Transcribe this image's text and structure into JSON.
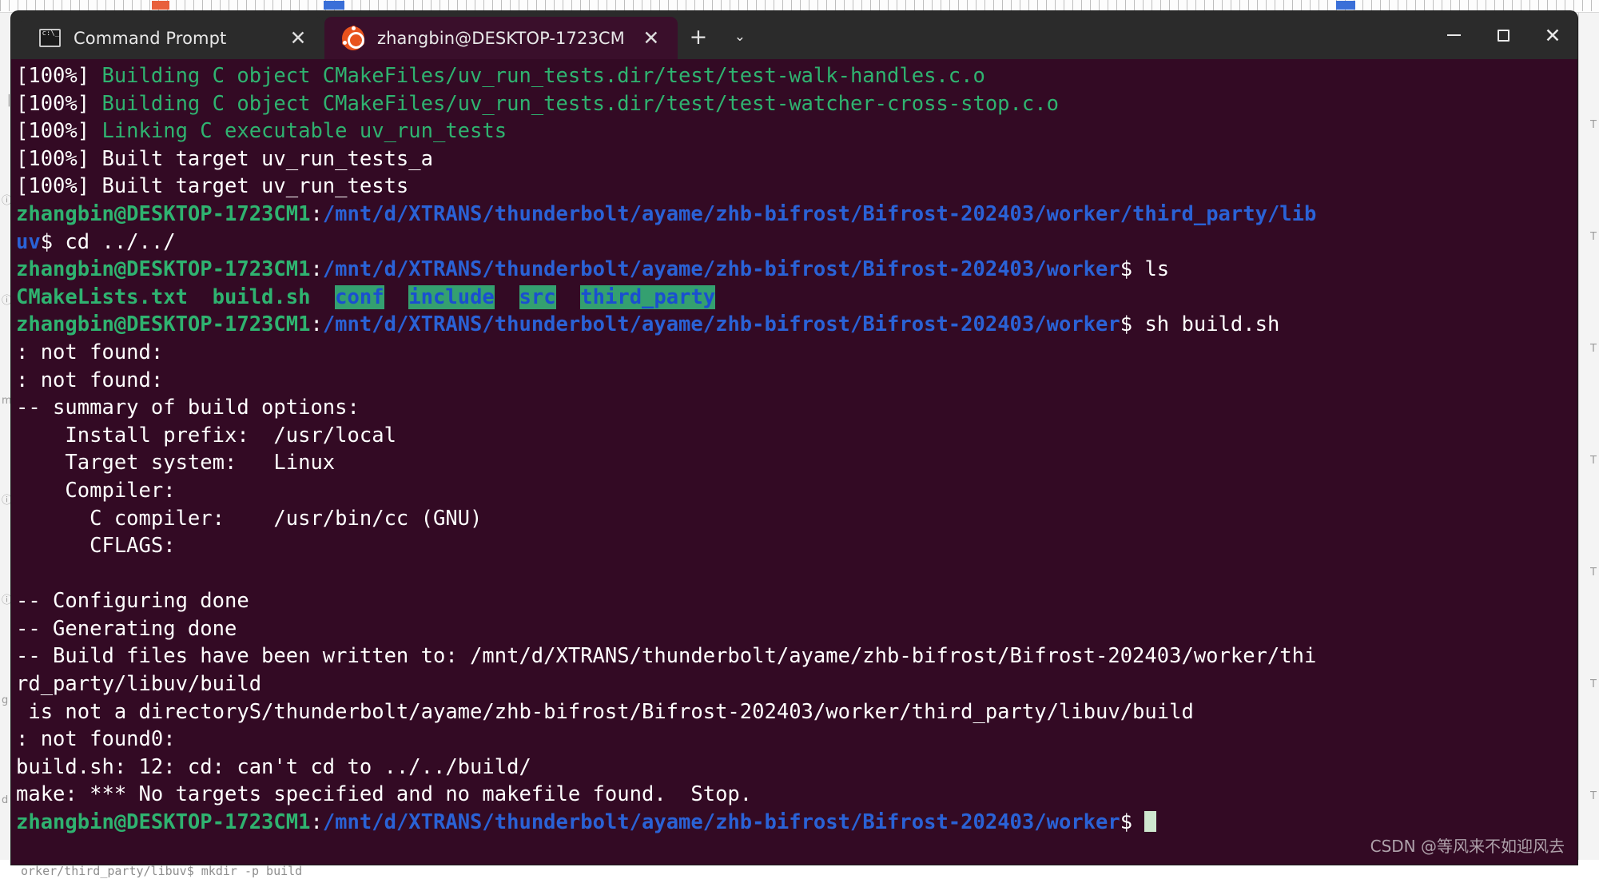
{
  "window": {
    "tabs": [
      {
        "label": "Command Prompt",
        "icon": "command-prompt-icon",
        "active": false,
        "close_label": "✕"
      },
      {
        "label": "zhangbin@DESKTOP-1723CM",
        "icon": "ubuntu-icon",
        "active": true,
        "close_label": "✕"
      }
    ],
    "new_tab_label": "+",
    "tab_dropdown_label": "⌄",
    "controls": {
      "minimize": "—",
      "maximize": "□",
      "close": "✕"
    }
  },
  "terminal": {
    "colors": {
      "background": "#330a24",
      "foreground": "#ffffff",
      "green": "#2fb370",
      "blue": "#2a62d6",
      "dir_highlight_bg": "#34a070",
      "dir_highlight_fg": "#1a4fd0",
      "cursor": "#cfe7cf"
    },
    "lines": [
      {
        "segments": [
          {
            "text": "[100%] ",
            "class": "c-white"
          },
          {
            "text": "Building C object CMakeFiles/uv_run_tests.dir/test/test-walk-handles.c.o",
            "class": "c-green"
          }
        ]
      },
      {
        "segments": [
          {
            "text": "[100%] ",
            "class": "c-white"
          },
          {
            "text": "Building C object CMakeFiles/uv_run_tests.dir/test/test-watcher-cross-stop.c.o",
            "class": "c-green"
          }
        ]
      },
      {
        "segments": [
          {
            "text": "[100%] ",
            "class": "c-white"
          },
          {
            "text": "Linking C executable uv_run_tests",
            "class": "c-green"
          }
        ]
      },
      {
        "segments": [
          {
            "text": "[100%] Built target uv_run_tests_a",
            "class": "c-white"
          }
        ]
      },
      {
        "segments": [
          {
            "text": "[100%] Built target uv_run_tests",
            "class": "c-white"
          }
        ]
      },
      {
        "segments": [
          {
            "text": "zhangbin@DESKTOP-1723CM1",
            "class": "c-green c-bold"
          },
          {
            "text": ":",
            "class": "c-white"
          },
          {
            "text": "/mnt/d/XTRANS/thunderbolt/ayame/zhb-bifrost/Bifrost-202403/worker/third_party/lib",
            "class": "c-blue c-bold"
          }
        ]
      },
      {
        "segments": [
          {
            "text": "uv",
            "class": "c-blue c-bold"
          },
          {
            "text": "$ cd ../../",
            "class": "c-white"
          }
        ]
      },
      {
        "segments": [
          {
            "text": "zhangbin@DESKTOP-1723CM1",
            "class": "c-green c-bold"
          },
          {
            "text": ":",
            "class": "c-white"
          },
          {
            "text": "/mnt/d/XTRANS/thunderbolt/ayame/zhb-bifrost/Bifrost-202403/worker",
            "class": "c-blue c-bold"
          },
          {
            "text": "$ ls",
            "class": "c-white"
          }
        ]
      },
      {
        "segments": [
          {
            "text": "CMakeLists.txt  build.sh  ",
            "class": "c-green c-bold"
          },
          {
            "text": "conf",
            "class": "dir-hl"
          },
          {
            "text": "  ",
            "class": "c-white"
          },
          {
            "text": "include",
            "class": "dir-hl"
          },
          {
            "text": "  ",
            "class": "c-white"
          },
          {
            "text": "src",
            "class": "dir-hl"
          },
          {
            "text": "  ",
            "class": "c-white"
          },
          {
            "text": "third_party",
            "class": "dir-hl"
          }
        ]
      },
      {
        "segments": [
          {
            "text": "zhangbin@DESKTOP-1723CM1",
            "class": "c-green c-bold"
          },
          {
            "text": ":",
            "class": "c-white"
          },
          {
            "text": "/mnt/d/XTRANS/thunderbolt/ayame/zhb-bifrost/Bifrost-202403/worker",
            "class": "c-blue c-bold"
          },
          {
            "text": "$ sh build.sh",
            "class": "c-white"
          }
        ]
      },
      {
        "segments": [
          {
            "text": ": not found:",
            "class": "c-white"
          }
        ]
      },
      {
        "segments": [
          {
            "text": ": not found:",
            "class": "c-white"
          }
        ]
      },
      {
        "segments": [
          {
            "text": "-- summary of build options:",
            "class": "c-white"
          }
        ]
      },
      {
        "segments": [
          {
            "text": "    Install prefix:  /usr/local",
            "class": "c-white"
          }
        ]
      },
      {
        "segments": [
          {
            "text": "    Target system:   Linux",
            "class": "c-white"
          }
        ]
      },
      {
        "segments": [
          {
            "text": "    Compiler:",
            "class": "c-white"
          }
        ]
      },
      {
        "segments": [
          {
            "text": "      C compiler:    /usr/bin/cc (GNU)",
            "class": "c-white"
          }
        ]
      },
      {
        "segments": [
          {
            "text": "      CFLAGS:",
            "class": "c-white"
          }
        ]
      },
      {
        "segments": [
          {
            "text": "",
            "class": "c-white"
          }
        ]
      },
      {
        "segments": [
          {
            "text": "-- Configuring done",
            "class": "c-white"
          }
        ]
      },
      {
        "segments": [
          {
            "text": "-- Generating done",
            "class": "c-white"
          }
        ]
      },
      {
        "segments": [
          {
            "text": "-- Build files have been written to: /mnt/d/XTRANS/thunderbolt/ayame/zhb-bifrost/Bifrost-202403/worker/thi",
            "class": "c-white"
          }
        ]
      },
      {
        "segments": [
          {
            "text": "rd_party/libuv/build",
            "class": "c-white"
          }
        ]
      },
      {
        "segments": [
          {
            "text": " is not a directoryS/thunderbolt/ayame/zhb-bifrost/Bifrost-202403/worker/third_party/libuv/build",
            "class": "c-white"
          }
        ]
      },
      {
        "segments": [
          {
            "text": ": not found0:",
            "class": "c-white"
          }
        ]
      },
      {
        "segments": [
          {
            "text": "build.sh: 12: cd: can't cd to ../../build/",
            "class": "c-white"
          }
        ]
      },
      {
        "segments": [
          {
            "text": "make: *** No targets specified and no makefile found.  Stop.",
            "class": "c-white"
          }
        ]
      },
      {
        "segments": [
          {
            "text": "zhangbin@DESKTOP-1723CM1",
            "class": "c-green c-bold"
          },
          {
            "text": ":",
            "class": "c-white"
          },
          {
            "text": "/mnt/d/XTRANS/thunderbolt/ayame/zhb-bifrost/Bifrost-202403/worker",
            "class": "c-blue c-bold"
          },
          {
            "text": "$ ",
            "class": "c-white"
          },
          {
            "text": "█",
            "class": "cursor-token"
          }
        ]
      }
    ],
    "watermark": "CSDN @等风来不如迎风去"
  },
  "background": {
    "bottom_text": "orker/third_party/libuv$ mkdir -p build",
    "left_rail_marks": [
      "▕",
      "ⓘ",
      "ⓘ",
      "m",
      "ⓘ",
      "ⓘ",
      "g",
      "d"
    ],
    "right_rail_marks": [
      "T",
      "T",
      "T",
      "T",
      "T",
      "T",
      "T"
    ]
  }
}
